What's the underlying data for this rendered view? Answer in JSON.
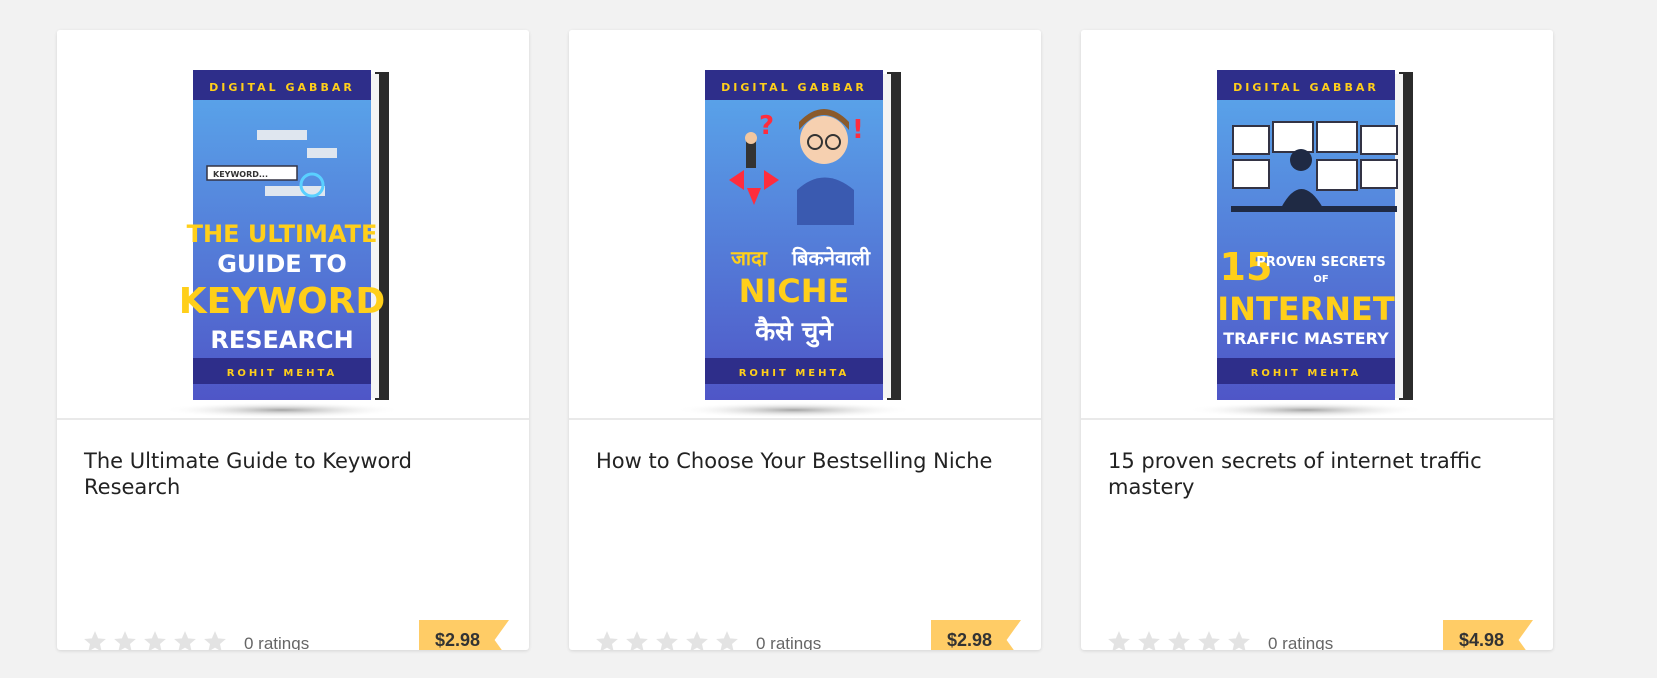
{
  "products": [
    {
      "title": "The Ultimate Guide to Keyword Research",
      "ratings_label": "0 ratings",
      "rating": 0,
      "price": "$2.98",
      "cover": {
        "top_text": "DIGITAL GABBAR",
        "search_text": "KEYWORD...",
        "lines": [
          "THE ULTIMATE",
          "GUIDE TO",
          "KEYWORD",
          "RESEARCH"
        ],
        "author": "ROHIT MEHTA"
      }
    },
    {
      "title": "How to Choose Your Bestselling Niche",
      "ratings_label": "0 ratings",
      "rating": 0,
      "price": "$2.98",
      "cover": {
        "top_text": "DIGITAL GABBAR",
        "lines": [
          "जादा",
          "बिकनेवाली",
          "NICHE",
          "कैसे चुने"
        ],
        "author": "ROHIT MEHTA"
      }
    },
    {
      "title": "15 proven secrets of internet traffic mastery",
      "ratings_label": "0 ratings",
      "rating": 0,
      "price": "$4.98",
      "cover": {
        "top_text": "DIGITAL GABBAR",
        "lines": [
          "15",
          "PROVEN SECRETS",
          "OF",
          "INTERNET",
          "TRAFFIC MASTERY"
        ],
        "author": "ROHIT MEHTA"
      }
    }
  ],
  "colors": {
    "price_tag": "#ffcc66",
    "star_empty": "#e3e3e3",
    "cover_gold": "#ffcf1a",
    "cover_navy": "#2e2e8a"
  }
}
